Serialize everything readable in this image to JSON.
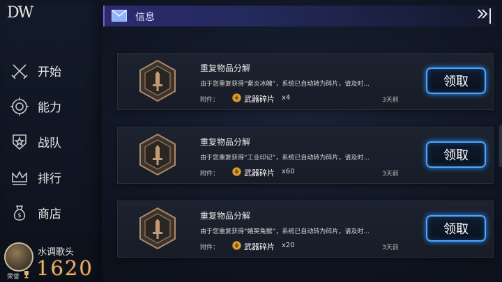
{
  "sidebar": {
    "logo": "DW",
    "items": [
      {
        "label": "开始",
        "icon": "crossed-swords-icon"
      },
      {
        "label": "能力",
        "icon": "gear-icon"
      },
      {
        "label": "战队",
        "icon": "star-shield-icon"
      },
      {
        "label": "排行",
        "icon": "crown-icon"
      },
      {
        "label": "商店",
        "icon": "money-bag-icon"
      }
    ],
    "profile": {
      "name": "水调歌头",
      "honor_label": "荣誉",
      "score": "1620"
    }
  },
  "header": {
    "title": "信息",
    "icon": "mail-icon",
    "close_icon": "exit-icon"
  },
  "messages": [
    {
      "title": "重复物品分解",
      "desc": "由于您重复获得“紫炎冰魄”，系统已自动转为碎片，请及时...",
      "attach_label": "附件：",
      "item_name": "武器碎片",
      "item_qty": "x4",
      "time": "3天前",
      "button_label": "领取"
    },
    {
      "title": "重复物品分解",
      "desc": "由于您重复获得“工业印记”，系统已自动转为碎片，请及时...",
      "attach_label": "附件：",
      "item_name": "武器碎片",
      "item_qty": "x60",
      "time": "3天前",
      "button_label": "领取"
    },
    {
      "title": "重复物品分解",
      "desc": "由于您重复获得“嬉笑兔猴”，系统已自动转为碎片，请及时...",
      "attach_label": "附件：",
      "item_name": "武器碎片",
      "item_qty": "x20",
      "time": "3天前",
      "button_label": "领取"
    }
  ],
  "colors": {
    "accent_blue": "#49a8ff",
    "header_purple": "#2b2a6f",
    "score_gold": "#e8b26f",
    "badge_bronze": "#b08865"
  }
}
